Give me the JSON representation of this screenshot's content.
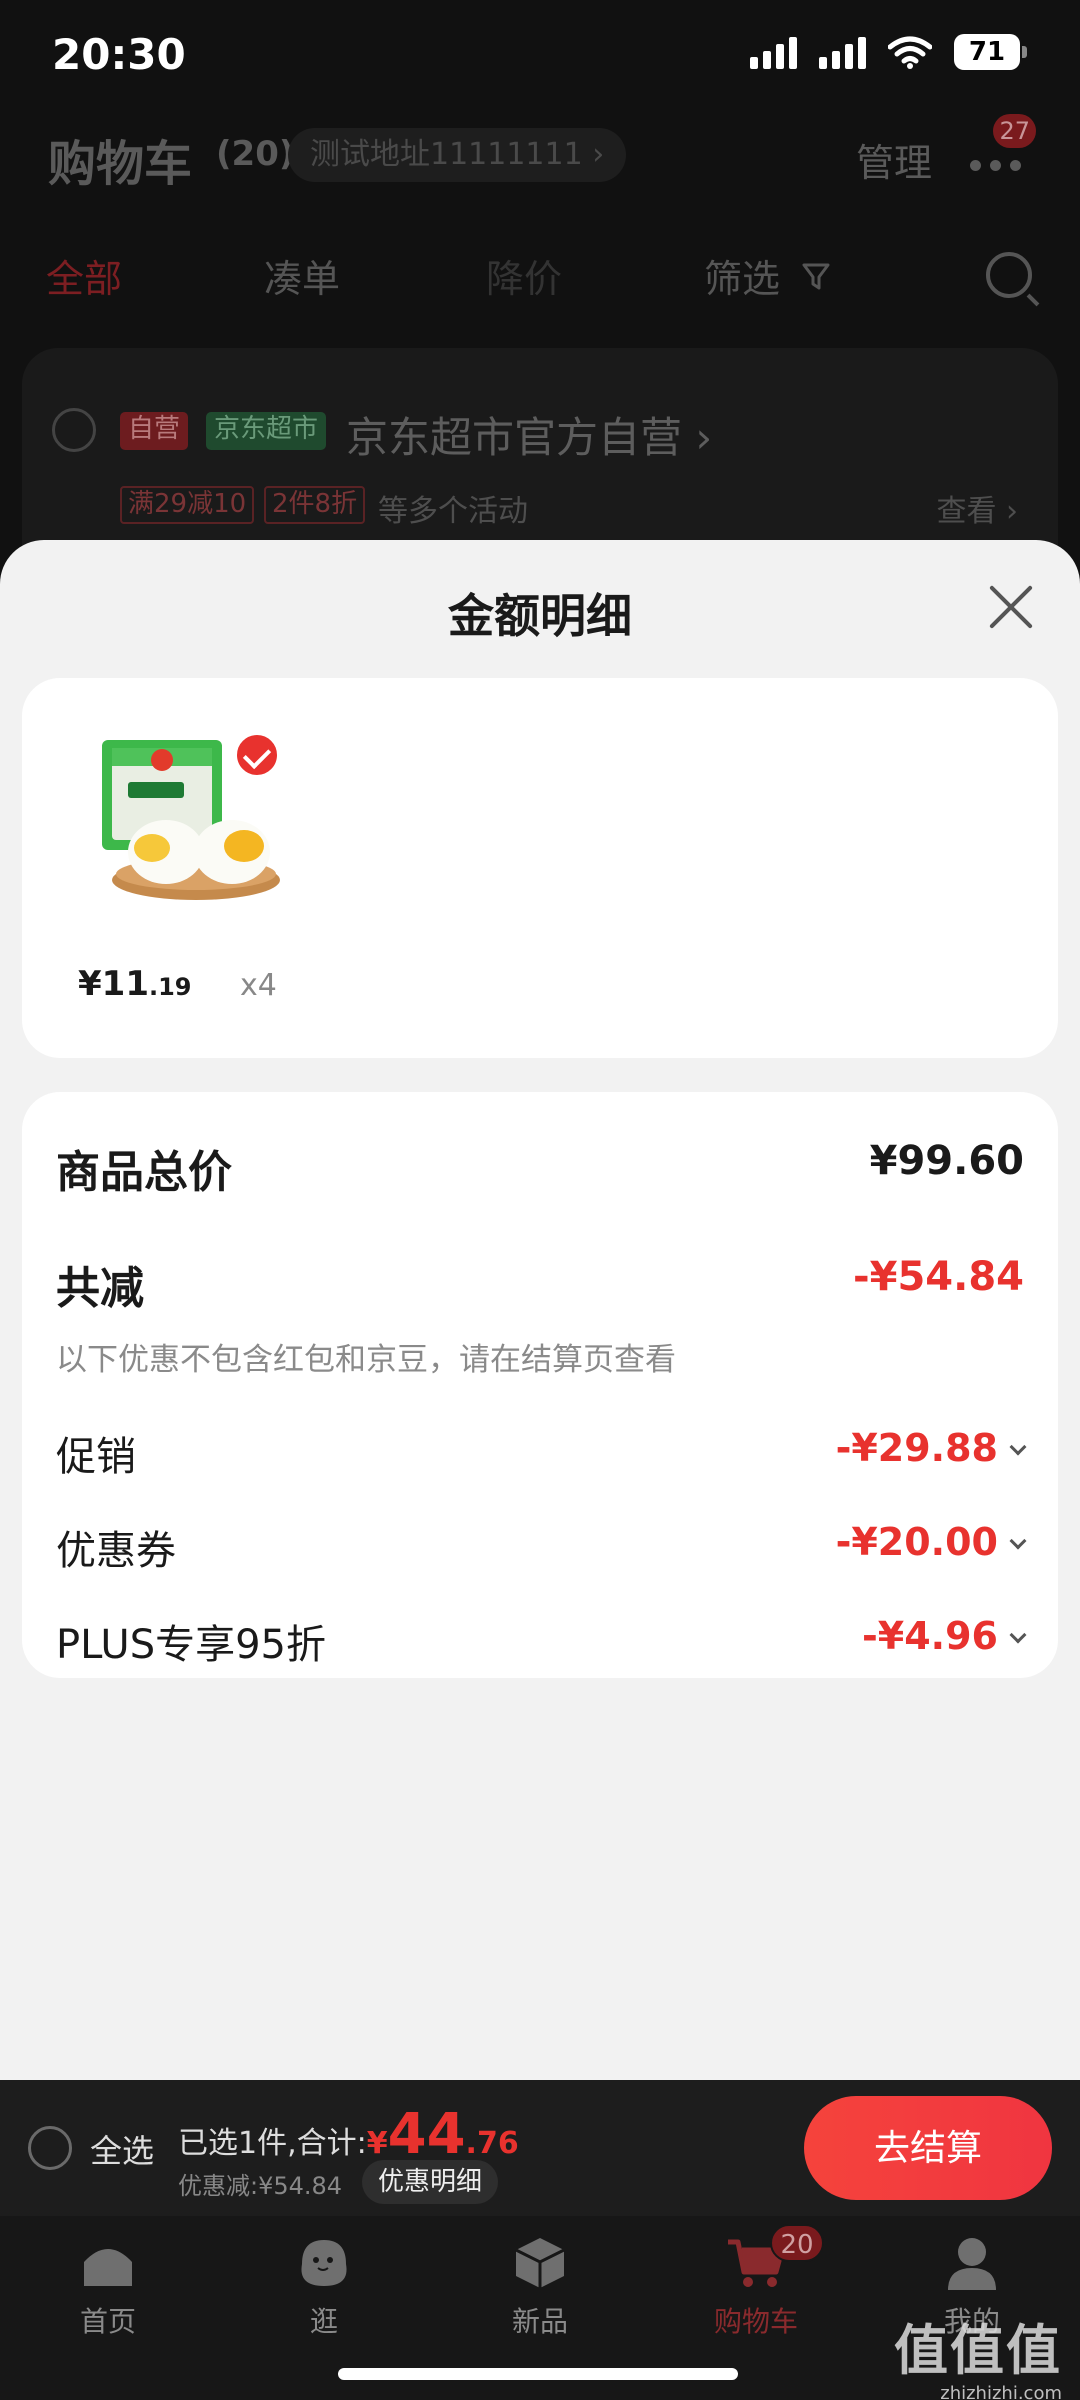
{
  "status_bar": {
    "time": "20:30",
    "battery": "71"
  },
  "header": {
    "title": "购物车",
    "count": "(20)",
    "address": "测试地址11111111 ›",
    "manage": "管理",
    "message_badge": "27"
  },
  "filters": {
    "all": "全部",
    "combine": "凑单",
    "price_drop": "降价",
    "filter": "筛选"
  },
  "store": {
    "tag_ziying": "自营",
    "tag_jd": "京东超市",
    "name": "京东超市官方自营 ›",
    "promo1": "满29减10",
    "promo2": "2件8折",
    "promo_more": "等多个活动",
    "view": "查看 ›"
  },
  "sheet": {
    "title": "金额明细",
    "product": {
      "price_int": "¥11",
      "price_dec": ".19",
      "qty": "x4"
    },
    "total_label": "商品总价",
    "total_value": "¥99.60",
    "reduce_label": "共减",
    "reduce_value": "-¥54.84",
    "note": "以下优惠不包含红包和京豆，请在结算页查看",
    "promo_label": "促销",
    "promo_value": "-¥29.88",
    "coupon_label": "优惠券",
    "coupon_value": "-¥20.00",
    "plus_label": "PLUS专享95折",
    "plus_value": "-¥4.96"
  },
  "checkout": {
    "select_all": "全选",
    "selected_text": "已选1件,合计:",
    "currency": "¥",
    "total_int": "44",
    "total_dec": ".76",
    "discount": "优惠减:¥54.84",
    "detail_button": "优惠明细",
    "checkout_button": "去结算"
  },
  "tabbar": {
    "home": "首页",
    "browse": "逛",
    "new": "新品",
    "cart": "购物车",
    "cart_badge": "20",
    "mine": "我的"
  },
  "watermark": {
    "line1": "值值值",
    "line2": "zhizhizhi.com"
  },
  "colors": {
    "accent_red": "#e8322e",
    "sheet_bg": "#f2f2f2",
    "bar_bg": "#1d1d1d"
  }
}
